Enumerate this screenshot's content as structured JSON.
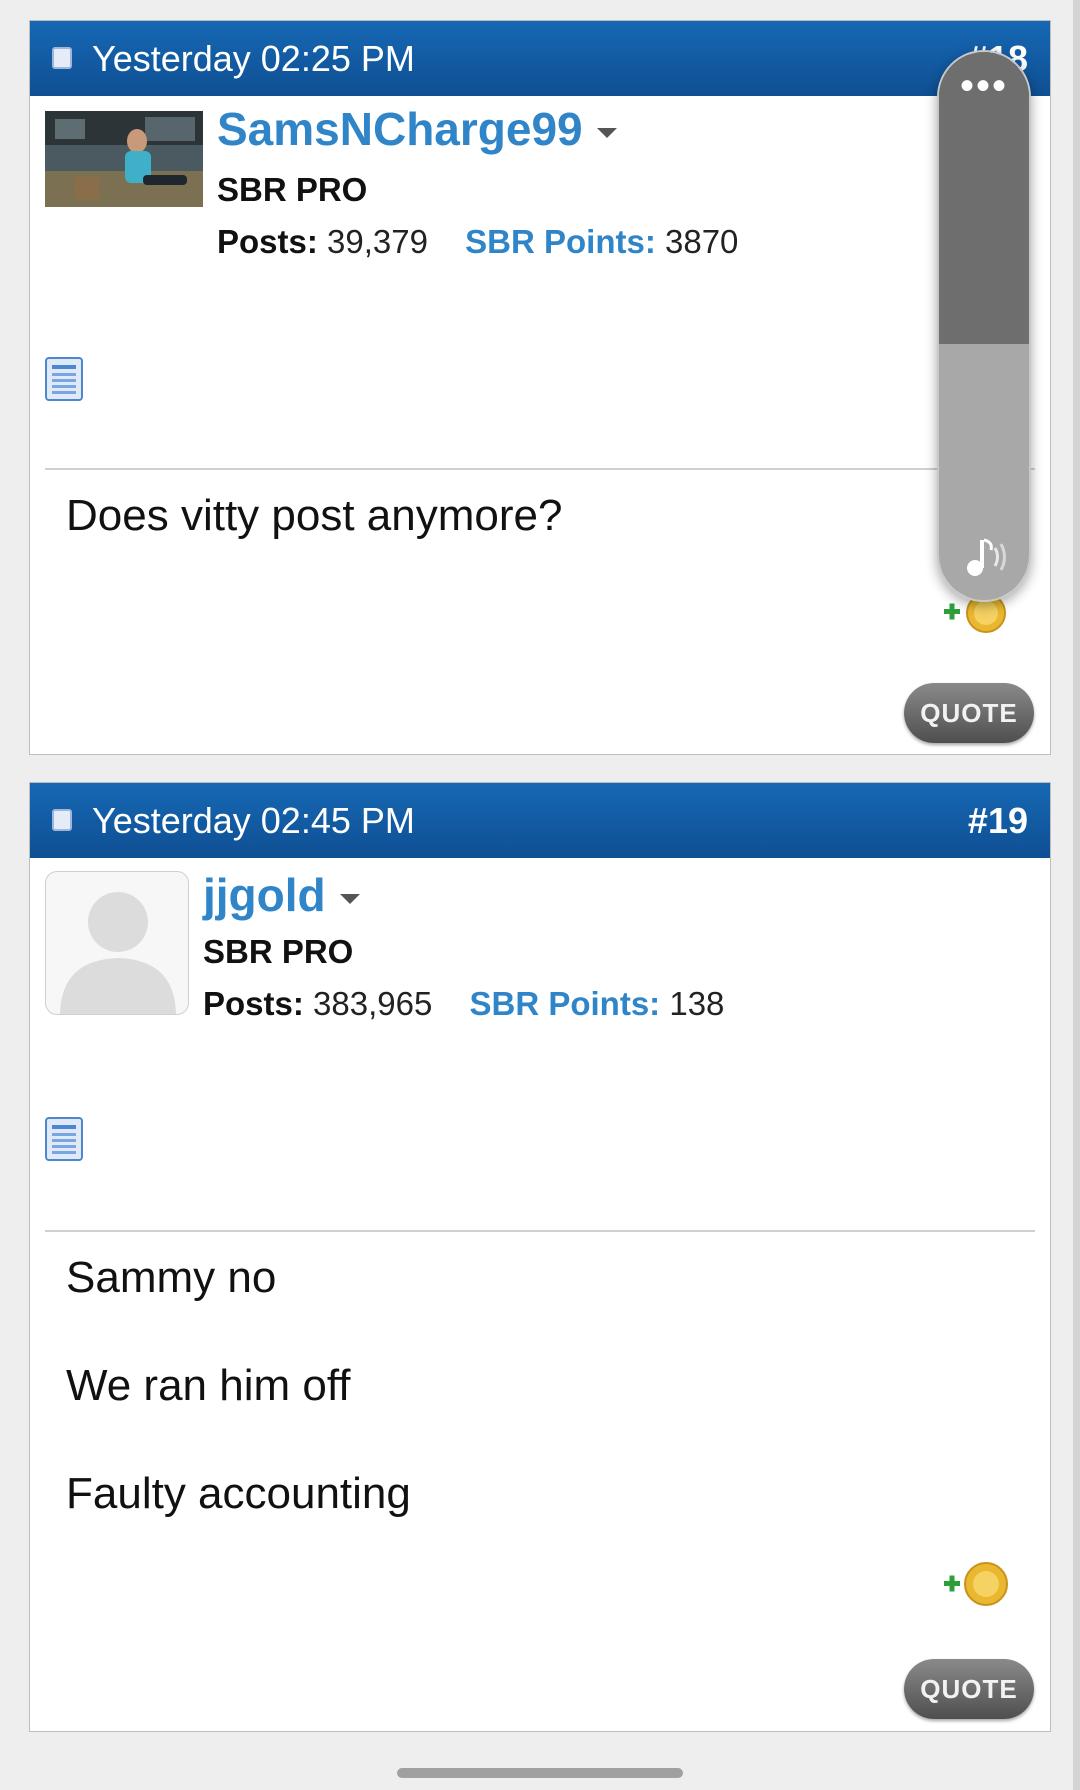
{
  "posts": [
    {
      "date": "Yesterday 02:25 PM",
      "number": "#18",
      "username": "SamsNCharge99",
      "rank": "SBR PRO",
      "posts_label": "Posts:",
      "posts_count": "39,379",
      "points_label": "SBR Points:",
      "points_value": "3870",
      "message_lines": [
        "Does vitty post anymore?"
      ],
      "quote_label": "QUOTE",
      "avatar": "user-photo"
    },
    {
      "date": "Yesterday 02:45 PM",
      "number": "#19",
      "username": "jjgold",
      "rank": "SBR PRO",
      "posts_label": "Posts:",
      "posts_count": "383,965",
      "points_label": "SBR Points:",
      "points_value": "138",
      "message_lines": [
        "Sammy no",
        "We ran him off",
        "Faulty accounting"
      ],
      "quote_label": "QUOTE",
      "avatar": "default-avatar"
    }
  ],
  "overlay": {
    "more_label": "•••",
    "icons": [
      "more-icon",
      "sound-icon"
    ]
  },
  "colors": {
    "header_blue": "#1262aa",
    "username_blue": "#2f85c8",
    "quote_button": "#5f5f5f"
  }
}
